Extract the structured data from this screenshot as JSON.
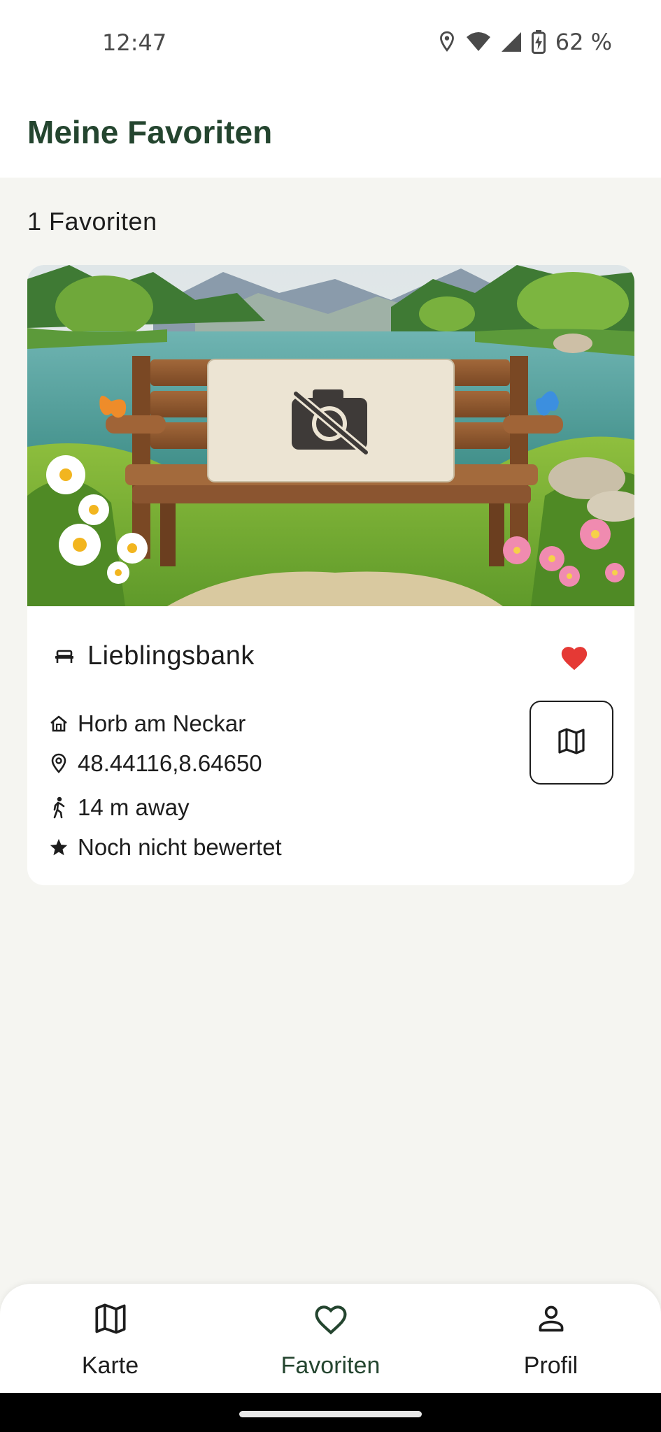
{
  "status_bar": {
    "time": "12:47",
    "battery": "62 %",
    "icons": [
      "location-icon",
      "wifi-icon",
      "signal-icon",
      "battery-charging-icon"
    ]
  },
  "app_bar": {
    "title": "Meine Favoriten"
  },
  "favorites_count": "1 Favoriten",
  "card": {
    "image_icon": "camera-off-icon",
    "title": "Lieblingsbank",
    "title_icon": "bench-icon",
    "favorite_icon": "heart-filled-icon",
    "favorite_color": "#e53935",
    "rows": [
      {
        "icon": "home-icon",
        "text": "Horb am Neckar"
      },
      {
        "icon": "location-pin-icon",
        "text": "48.44116,8.64650"
      },
      {
        "icon": "walk-icon",
        "text": "14 m away"
      },
      {
        "icon": "star-icon",
        "text": "Noch nicht bewertet"
      }
    ],
    "map_button_icon": "map-icon"
  },
  "bottom_nav": {
    "items": [
      {
        "label": "Karte",
        "icon": "map-icon",
        "active": false
      },
      {
        "label": "Favoriten",
        "icon": "heart-outline-icon",
        "active": true
      },
      {
        "label": "Profil",
        "icon": "person-icon",
        "active": false
      }
    ]
  },
  "colors": {
    "accent": "#24452f",
    "background": "#f5f5f1",
    "heart": "#e53935"
  }
}
